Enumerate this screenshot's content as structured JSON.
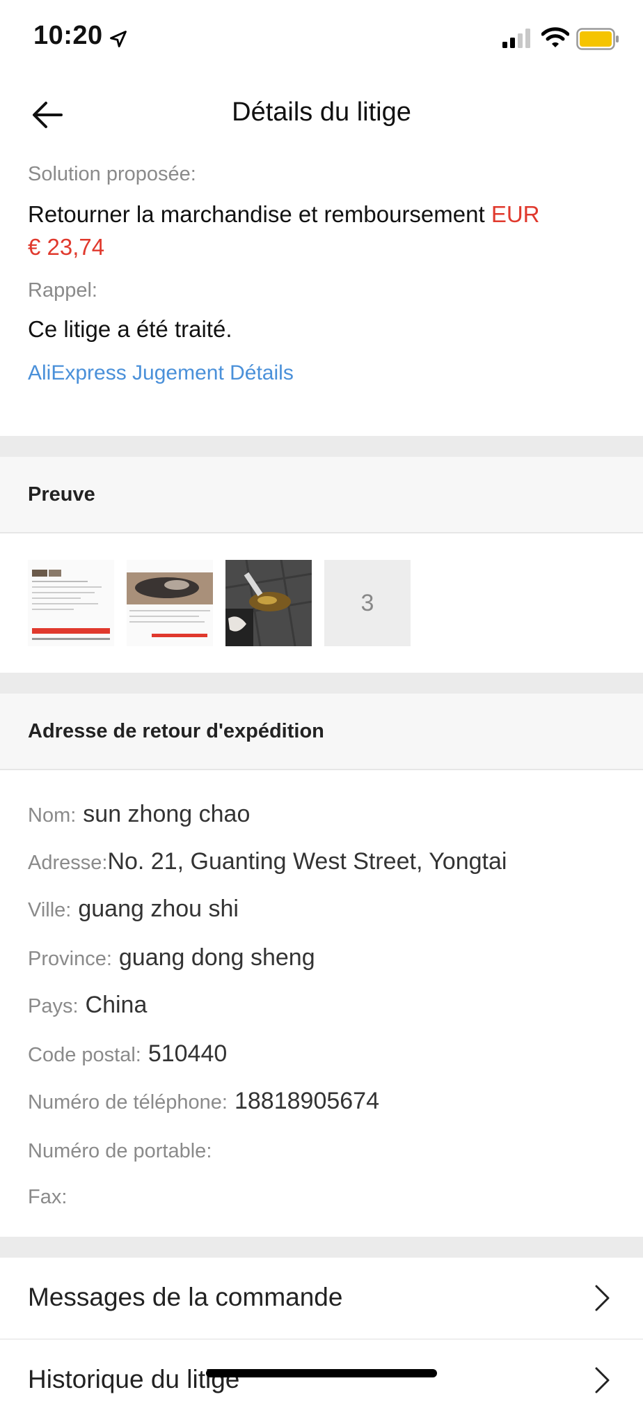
{
  "status_bar": {
    "time": "10:20"
  },
  "header": {
    "title": "Détails du litige"
  },
  "solution": {
    "label": "Solution proposée:",
    "text": "Retourner la marchandise et remboursement",
    "currency": "EUR",
    "amount": "€ 23,74"
  },
  "reminder": {
    "label": "Rappel:",
    "text": "Ce litige a été traité.",
    "link": "AliExpress Jugement Détails"
  },
  "evidence": {
    "title": "Preuve",
    "more_count": "3"
  },
  "return_address": {
    "title": "Adresse de retour d'expédition",
    "fields": [
      {
        "key": "Nom:",
        "value": "sun zhong chao"
      },
      {
        "key": "Adresse:",
        "value": "No. 21, Guanting West Street, Yongtai"
      },
      {
        "key": "Ville:",
        "value": "guang zhou shi"
      },
      {
        "key": "Province:",
        "value": "guang dong sheng"
      },
      {
        "key": "Pays:",
        "value": "China"
      },
      {
        "key": "Code postal:",
        "value": "510440"
      },
      {
        "key": "Numéro de téléphone:",
        "value": "18818905674"
      },
      {
        "key": "Numéro de portable:",
        "value": ""
      },
      {
        "key": "Fax:",
        "value": ""
      }
    ]
  },
  "menu": [
    {
      "label": "Messages de la commande"
    },
    {
      "label": "Historique du litige"
    }
  ],
  "colors": {
    "accent_red": "#e0392d",
    "link_blue": "#4a90d9",
    "battery_yellow": "#f5c400"
  }
}
